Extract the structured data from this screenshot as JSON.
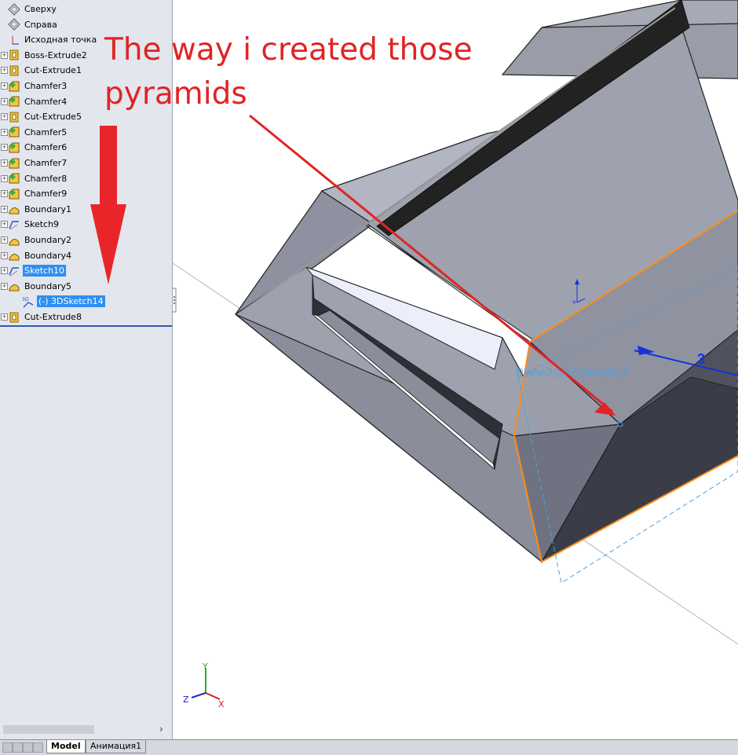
{
  "feature_tree": {
    "items": [
      {
        "label": "Сверху",
        "icon": "plane-icon"
      },
      {
        "label": "Справа",
        "icon": "plane-icon"
      },
      {
        "label": "Исходная точка",
        "icon": "origin-icon"
      },
      {
        "label": "Boss-Extrude2",
        "icon": "extrude-icon"
      },
      {
        "label": "Cut-Extrude1",
        "icon": "extrude-icon"
      },
      {
        "label": "Chamfer3",
        "icon": "chamfer-icon"
      },
      {
        "label": "Chamfer4",
        "icon": "chamfer-icon"
      },
      {
        "label": "Cut-Extrude5",
        "icon": "extrude-icon"
      },
      {
        "label": "Chamfer5",
        "icon": "chamfer-icon"
      },
      {
        "label": "Chamfer6",
        "icon": "chamfer-icon"
      },
      {
        "label": "Chamfer7",
        "icon": "chamfer-icon"
      },
      {
        "label": "Chamfer8",
        "icon": "chamfer-icon"
      },
      {
        "label": "Chamfer9",
        "icon": "chamfer-icon"
      },
      {
        "label": "Boundary1",
        "icon": "boundary-icon"
      },
      {
        "label": "Sketch9",
        "icon": "sketch-icon"
      },
      {
        "label": "Boundary2",
        "icon": "boundary-icon"
      },
      {
        "label": "Boundary4",
        "icon": "boundary-icon"
      },
      {
        "label": "Sketch10",
        "icon": "sketch-icon"
      },
      {
        "label": "Boundary5",
        "icon": "boundary-icon"
      },
      {
        "label": "(-) 3DSketch14",
        "icon": "3d-sketch-icon"
      },
      {
        "label": "Cut-Extrude8",
        "icon": "extrude-icon"
      }
    ],
    "selected": [
      "Sketch10",
      "(-) 3DSketch14"
    ]
  },
  "viewport": {
    "annotation": "The way i created those pyramids",
    "sketch_label": "Plane2@3DSketch14",
    "dimension_value": "3",
    "triad_labels": {
      "x": "X",
      "y": "Y",
      "z": "Z"
    },
    "colors": {
      "annotation": "#e02424",
      "face": "#8c909c",
      "edge": "#ff8c1a",
      "sketch": "#4aa0e0"
    }
  },
  "tabs": [
    {
      "label": "Model",
      "active": true
    },
    {
      "label": "Анимация1",
      "active": false
    }
  ],
  "scroll": {
    "right_arrow": "›"
  }
}
